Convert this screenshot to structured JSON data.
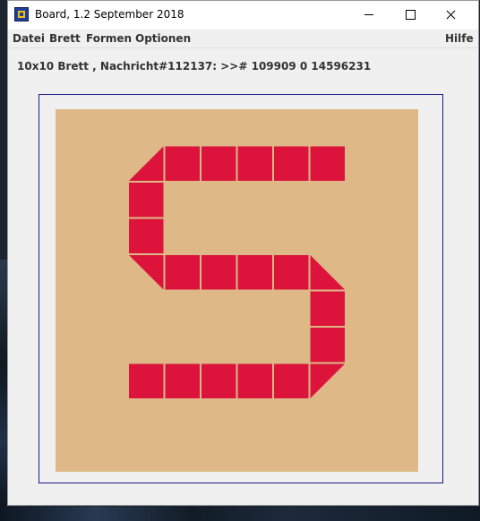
{
  "window": {
    "title": "Board, 1.2 September 2018"
  },
  "menu": {
    "left": [
      "Datei",
      "Brett",
      "Formen",
      "Optionen"
    ],
    "right": "Hilfe"
  },
  "status_text": "10x10 Brett , Nachricht#112137: >># 109909 0 14596231",
  "board": {
    "rows": 10,
    "cols": 10,
    "background": "#deb887",
    "cell_color": "#dc143c",
    "line_color": "#f0c090",
    "cells": [
      {
        "r": 1,
        "c": 2,
        "shape": "tri-br"
      },
      {
        "r": 1,
        "c": 3,
        "shape": "sq"
      },
      {
        "r": 1,
        "c": 4,
        "shape": "sq"
      },
      {
        "r": 1,
        "c": 5,
        "shape": "sq"
      },
      {
        "r": 1,
        "c": 6,
        "shape": "sq"
      },
      {
        "r": 1,
        "c": 7,
        "shape": "sq"
      },
      {
        "r": 2,
        "c": 2,
        "shape": "sq"
      },
      {
        "r": 3,
        "c": 2,
        "shape": "sq"
      },
      {
        "r": 4,
        "c": 2,
        "shape": "tri-tr"
      },
      {
        "r": 4,
        "c": 3,
        "shape": "sq"
      },
      {
        "r": 4,
        "c": 4,
        "shape": "sq"
      },
      {
        "r": 4,
        "c": 5,
        "shape": "sq"
      },
      {
        "r": 4,
        "c": 6,
        "shape": "sq"
      },
      {
        "r": 4,
        "c": 7,
        "shape": "tri-bl"
      },
      {
        "r": 5,
        "c": 7,
        "shape": "sq"
      },
      {
        "r": 6,
        "c": 7,
        "shape": "sq"
      },
      {
        "r": 7,
        "c": 2,
        "shape": "sq"
      },
      {
        "r": 7,
        "c": 3,
        "shape": "sq"
      },
      {
        "r": 7,
        "c": 4,
        "shape": "sq"
      },
      {
        "r": 7,
        "c": 5,
        "shape": "sq"
      },
      {
        "r": 7,
        "c": 6,
        "shape": "sq"
      },
      {
        "r": 7,
        "c": 7,
        "shape": "tri-tl"
      }
    ]
  }
}
